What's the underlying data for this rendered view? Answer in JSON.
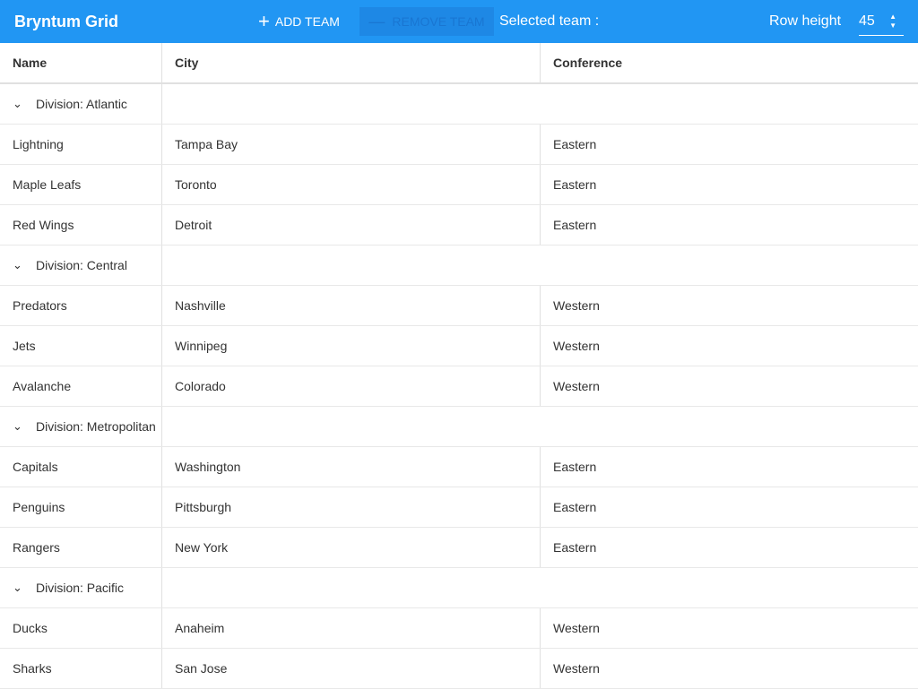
{
  "toolbar": {
    "title": "Bryntum Grid",
    "add_label": "Add Team",
    "remove_label": "Remove Team",
    "selected_label": "Selected team :",
    "row_height_label": "Row height",
    "row_height_value": "45"
  },
  "columns": [
    "Name",
    "City",
    "Conference"
  ],
  "groups": [
    {
      "label": "Division: Atlantic",
      "rows": [
        [
          "Lightning",
          "Tampa Bay",
          "Eastern"
        ],
        [
          "Maple Leafs",
          "Toronto",
          "Eastern"
        ],
        [
          "Red Wings",
          "Detroit",
          "Eastern"
        ]
      ]
    },
    {
      "label": "Division: Central",
      "rows": [
        [
          "Predators",
          "Nashville",
          "Western"
        ],
        [
          "Jets",
          "Winnipeg",
          "Western"
        ],
        [
          "Avalanche",
          "Colorado",
          "Western"
        ]
      ]
    },
    {
      "label": "Division: Metropolitan",
      "rows": [
        [
          "Capitals",
          "Washington",
          "Eastern"
        ],
        [
          "Penguins",
          "Pittsburgh",
          "Eastern"
        ],
        [
          "Rangers",
          "New York",
          "Eastern"
        ]
      ]
    },
    {
      "label": "Division: Pacific",
      "rows": [
        [
          "Ducks",
          "Anaheim",
          "Western"
        ],
        [
          "Sharks",
          "San Jose",
          "Western"
        ]
      ]
    }
  ]
}
